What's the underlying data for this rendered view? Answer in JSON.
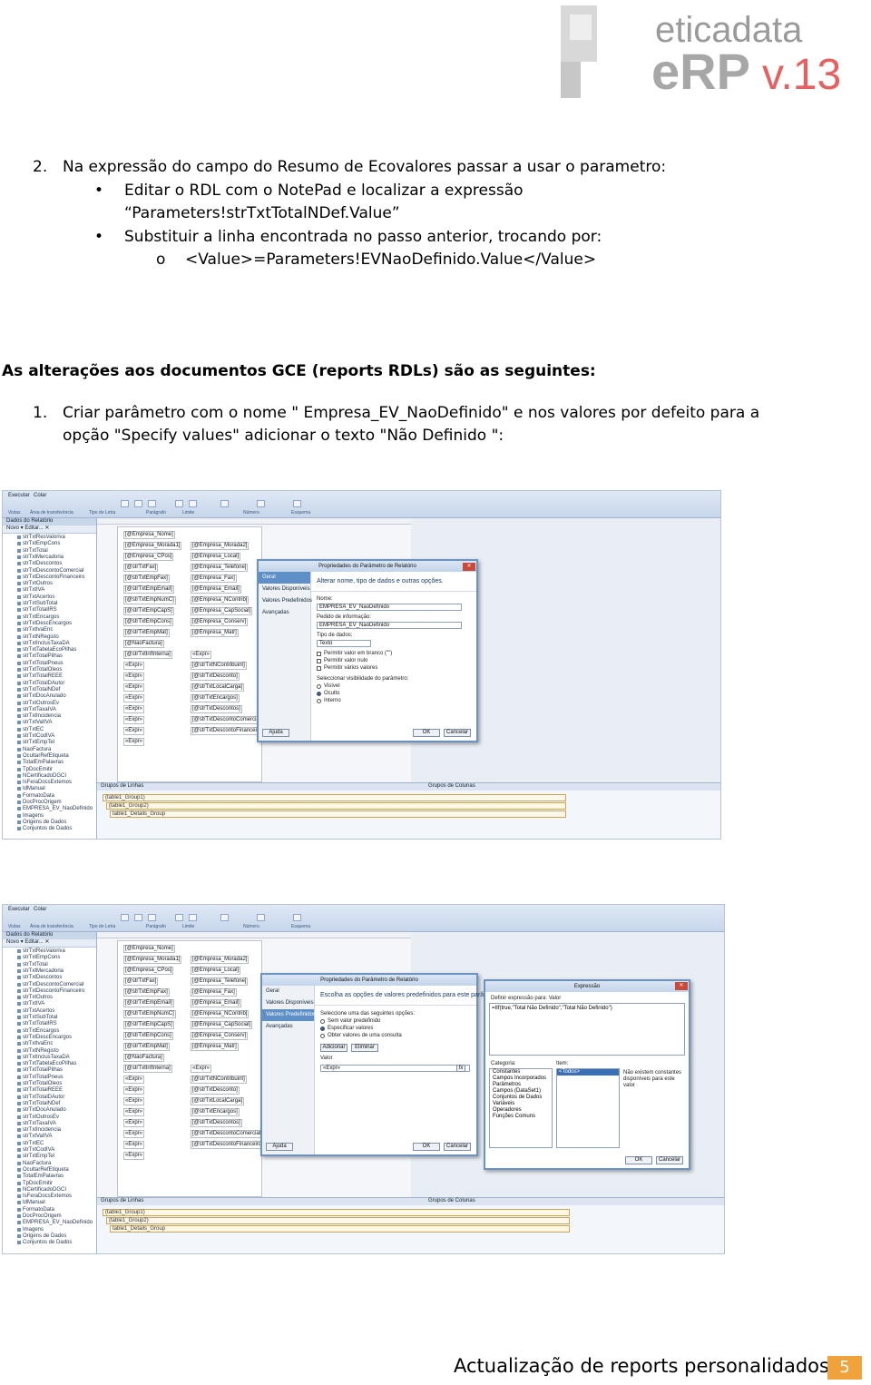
{
  "header": {
    "logo_text": "eticadata",
    "logo_sub": "eRP",
    "logo_version": "v.13"
  },
  "step2": {
    "number": "2.",
    "text": "Na expressão do campo do Resumo de Ecovalores passar a usar o parametro:",
    "bullet1_line1": "Editar o RDL com o NotePad e localizar a expressão",
    "bullet1_line2": "“Parameters!strTxtTotalNDef.Value”",
    "bullet2": "Substituir a linha encontrada no passo anterior, trocando por:",
    "sub_marker": "o",
    "sub_text": "<Value>=Parameters!EVNaoDefinido.Value</Value>"
  },
  "section": {
    "heading": "As alterações aos documentos GCE (reports RDLs) são as seguintes:",
    "step1_number": "1.",
    "step1_line1": "Criar parâmetro com o nome \" Empresa_EV_NaoDefinido\" e nos valores por defeito para a",
    "step1_line2": "opção \"Specify values\" adicionar o texto \"Não Definido \":"
  },
  "screenshot1": {
    "ribbon_tabs": [
      "Executar",
      "Colar"
    ],
    "ribbon_groups": [
      "Vistas",
      "Área de transferência",
      "Tipo de Letra",
      "Parágrafo",
      "Limite",
      "Número",
      "Esquema"
    ],
    "left_header": "Dados do Relatório",
    "left_toolbar": "Novo ▾  Editar...  ✕",
    "fields": [
      "strTxtResValoriva",
      "strTxtEmpCons",
      "strTxtTotal",
      "strTxtMercadoria",
      "strTxtDescontos",
      "strTxtDescontoComercial",
      "strTxtDescontoFinanceiro",
      "strTxtOutros",
      "strTxtIVA",
      "strTxtAcertos",
      "strTxtSubTotal",
      "strTxtTotalIRS",
      "strTxtEncargos",
      "strTxtDescEncargos",
      "strTxtIvaEnc",
      "strTxtNRegisto",
      "strTxtInclusTaxaDA",
      "strTxtTabelaEcoPilhas",
      "strTxtTotalPilhas",
      "strTxtTotalPneus",
      "strTxtTotalOleos",
      "strTxtTotalREEE",
      "strTxtTotalDAutor",
      "strTxtTotalNDef",
      "strTxtDocAnulado",
      "strTxtOutrosEv",
      "strTxtTaxaIVA",
      "strTxtIncidencia",
      "strTxtValIVA",
      "strTxtEC",
      "strTxtCodIVA",
      "strTxtEmpTel",
      "NaoFactura",
      "OcultarRefEtiqueta",
      "TotalEmPalavras",
      "TpDocEmitir",
      "NCertificadoDGCI",
      "IsFeraDocsExtemos",
      "IdManual",
      "FormatoData",
      "DocProcOrigem",
      "EMPRESA_EV_NaoDefinido",
      "Imagens",
      "Origens de Dados",
      "Conjuntos de Dados"
    ],
    "design_fields": [
      "[@Empresa_Nome]",
      "[@Empresa_Morada1]",
      "[@Empresa_Morada2]",
      "[@Empresa_CPos]",
      "[@Empresa_Local]",
      "[@strTxtFax]",
      "[@Empresa_Telefone]",
      "[@strTxtEmpFax]",
      "[@Empresa_Fax]",
      "[@strTxtEmpEmail]",
      "[@Empresa_Email]",
      "[@strTxtEmpNumC]",
      "[@Empresa_NContrib]",
      "[@strTxtEmpCapS]",
      "[@Empresa_CapSocial]",
      "[@strTxtEmpCons]",
      "[@Empresa_Conserv]",
      "[@strTxtEmpMat]",
      "[@Empresa_Matr]",
      "[@NaoFactura]",
      "[@strTxtInfInterna]",
      "«Expr»",
      "«Expr»",
      "[@strTxtNContribuint]",
      "«Expr»",
      "[@strTxtDesconto]",
      "«Expr»",
      "[@strTxtLocalCarga]",
      "«Expr»",
      "[@strTxtEncargos]",
      "«Expr»",
      "[@strTxtDescontos]",
      "«Expr»",
      "[@strTxtDescontoComercial]",
      "«Expr»",
      "[@strTxtDescontoFinanceiro]",
      "«Expr»"
    ],
    "bottom_left": "Grupos de Linhas",
    "bottom_right": "Grupos de Colunas",
    "groups": [
      "(table1_Group1)",
      "(table1_Group2)",
      "table1_Details_Group"
    ],
    "dialog": {
      "title": "Propriedades do Parâmetro de Relatório",
      "nav": [
        "Geral",
        "Valores Disponíveis",
        "Valores Predefinidos",
        "Avançadas"
      ],
      "banner": "Alterar nome, tipo de dados e outras opções.",
      "name_label": "Nome:",
      "name_value": "EMPRESA_EV_NaoDefinido",
      "prompt_label": "Pedido de informação:",
      "prompt_value": "EMPRESA_EV_NaoDefinido",
      "type_label": "Tipo de dados:",
      "type_value": "Texto",
      "checks": [
        "Permitir valor em branco (\"\")",
        "Permitir valor nulo",
        "Permitir vários valores"
      ],
      "visibility_label": "Seleccionar visibilidade do parâmetro:",
      "radios": [
        "Visível",
        "Oculto",
        "Interno"
      ],
      "help": "Ajuda",
      "ok": "OK",
      "cancel": "Cancelar"
    }
  },
  "screenshot2": {
    "dialog": {
      "title": "Propriedades do Parâmetro de Relatório",
      "nav": [
        "Geral",
        "Valores Disponíveis",
        "Valores Predefinidos",
        "Avançadas"
      ],
      "banner": "Escolha as opções de valores predefinidos para este parâmetro.",
      "choose_label": "Seleccione uma das seguintes opções:",
      "radios": [
        "Sem valor predefinido",
        "Especificar valores",
        "Obter valores de uma consulta"
      ],
      "add": "Adicionar",
      "remove": "Eliminar",
      "value_header": "Valor",
      "value_cell": "«Expr»",
      "help": "Ajuda",
      "ok": "OK",
      "cancel": "Cancelar"
    },
    "expr": {
      "title": "Expressão",
      "define_label": "Definir expressão para: Valor",
      "expression": "=IIf(true,\"Total Não Definido\",\"Total Não Definido\")",
      "category_label": "Categoria:",
      "categories": [
        "Constantes",
        "Campos Incorporados",
        "Parâmetros",
        "Campos (DataSet1)",
        "Conjuntos de Dados",
        "Variáveis",
        "Operadores",
        "Funções Comuns"
      ],
      "item_label": "Item:",
      "item_selected": "<Todos>",
      "note": "Não existem constantes disponíveis para este valor",
      "ok": "OK",
      "cancel": "Cancelar"
    }
  },
  "footer": {
    "title": "Actualização de reports personalidados",
    "page": "5"
  },
  "colors": {
    "accent_orange": "#f0a33c",
    "dialog_border": "#6b93c2",
    "logo_gray": "#9a9a9a",
    "logo_red": "#e56060"
  }
}
